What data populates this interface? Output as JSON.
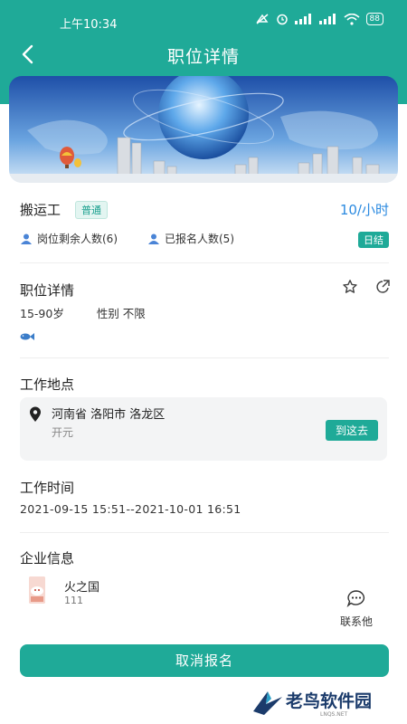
{
  "status": {
    "time": "上午10:34",
    "battery": "88"
  },
  "nav": {
    "title": "职位详情"
  },
  "job": {
    "title": "搬运工",
    "tag": "普通",
    "salary": "10/小时",
    "remaining_label": "岗位剩余人数(6)",
    "registered_label": "已报名人数(5)",
    "settlement": "日结"
  },
  "detail": {
    "title": "职位详情",
    "age": "15-90岁",
    "gender": "性别 不限"
  },
  "location": {
    "title": "工作地点",
    "address": "河南省 洛阳市 洛龙区",
    "detail": "开元",
    "go_label": "到这去"
  },
  "worktime": {
    "title": "工作时间",
    "range": "2021-09-15 15:51--2021-10-01 16:51"
  },
  "company": {
    "title": "企业信息",
    "name": "火之国",
    "sub": "111",
    "contact_label": "联系他"
  },
  "action": {
    "cancel_label": "取消报名"
  },
  "watermark": {
    "text": "老鸟软件园",
    "sub": "LNQS.NET"
  },
  "colors": {
    "primary": "#1faa98",
    "salary": "#2b8ae0"
  },
  "icons": [
    "back-arrow-icon",
    "star-icon",
    "share-icon",
    "person-icon",
    "fish-icon",
    "location-pin-icon",
    "chat-icon"
  ]
}
